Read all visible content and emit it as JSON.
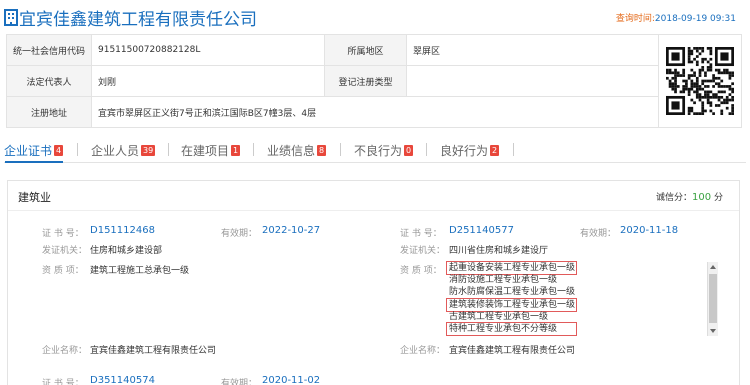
{
  "company": {
    "title": "宜宾佳鑫建筑工程有限责任公司",
    "query_time_label": "查询时间:",
    "query_time_value": "2018-09-19 09:31"
  },
  "info": {
    "credit_code_label": "统一社会信用代码",
    "credit_code": "91511500720882128L",
    "region_label": "所属地区",
    "region": "翠屏区",
    "legal_rep_label": "法定代表人",
    "legal_rep": "刘刚",
    "reg_type_label": "登记注册类型",
    "reg_type": "",
    "reg_address_label": "注册地址",
    "reg_address": "宜宾市翠屏区正义街7号正和滨江国际B区7幢3层、4层"
  },
  "tabs": [
    {
      "label": "企业证书",
      "count": "4"
    },
    {
      "label": "企业人员",
      "count": "39"
    },
    {
      "label": "在建项目",
      "count": "1"
    },
    {
      "label": "业绩信息",
      "count": "8"
    },
    {
      "label": "不良行为",
      "count": "0"
    },
    {
      "label": "良好行为",
      "count": "2"
    }
  ],
  "panel": {
    "category": "建筑业",
    "credit_label": "诚信分：",
    "credit_value": "100",
    "credit_unit": "分"
  },
  "labels": {
    "cert_no": "证  书  号：",
    "validity": "有效期：",
    "issuer": "发证机关：",
    "qualification": "资  质  项：",
    "company_name": "企业名称："
  },
  "certs": [
    {
      "cert_no": "D151112468",
      "validity": "2022-10-27",
      "issuer": "住房和城乡建设部",
      "qualifications": [
        "建筑工程施工总承包一级"
      ],
      "company_name": "宜宾佳鑫建筑工程有限责任公司"
    },
    {
      "cert_no": "D251140577",
      "validity": "2020-11-18",
      "issuer": "四川省住房和城乡建设厅",
      "qualifications": [
        "起重设备安装工程专业承包一级",
        "消防设施工程专业承包一级",
        "防水防腐保温工程专业承包一级",
        "建筑装修装饰工程专业承包一级",
        "古建筑工程专业承包一级",
        "特种工程专业承包不分等级"
      ],
      "company_name": "宜宾佳鑫建筑工程有限责任公司"
    },
    {
      "cert_no": "D351140574",
      "validity": "2020-11-02"
    }
  ],
  "colors": {
    "brand_blue": "#1a6fbe",
    "badge_red": "#e8473b",
    "credit_green": "#3aa241",
    "highlight_red": "#e15a5a"
  }
}
